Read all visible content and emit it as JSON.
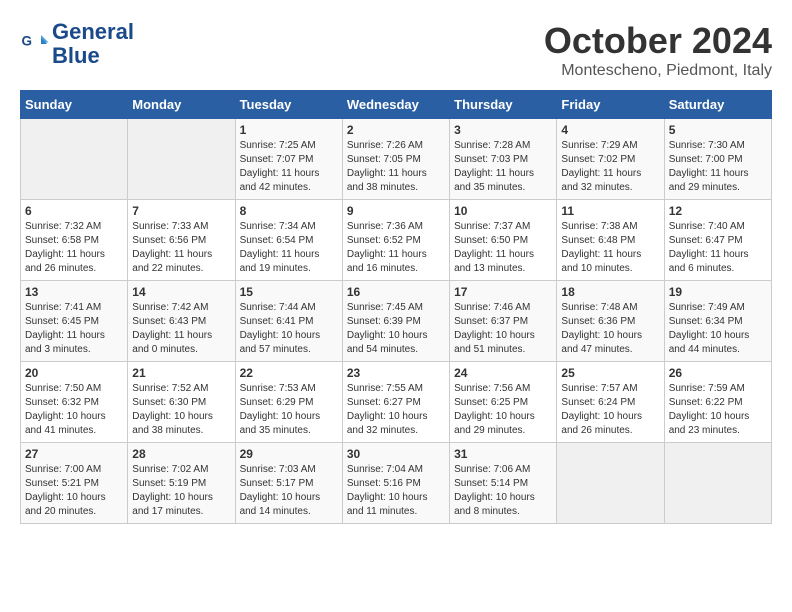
{
  "header": {
    "logo_line1": "General",
    "logo_line2": "Blue",
    "month": "October 2024",
    "location": "Montescheno, Piedmont, Italy"
  },
  "weekdays": [
    "Sunday",
    "Monday",
    "Tuesday",
    "Wednesday",
    "Thursday",
    "Friday",
    "Saturday"
  ],
  "weeks": [
    [
      {
        "day": "",
        "info": ""
      },
      {
        "day": "",
        "info": ""
      },
      {
        "day": "1",
        "info": "Sunrise: 7:25 AM\nSunset: 7:07 PM\nDaylight: 11 hours\nand 42 minutes."
      },
      {
        "day": "2",
        "info": "Sunrise: 7:26 AM\nSunset: 7:05 PM\nDaylight: 11 hours\nand 38 minutes."
      },
      {
        "day": "3",
        "info": "Sunrise: 7:28 AM\nSunset: 7:03 PM\nDaylight: 11 hours\nand 35 minutes."
      },
      {
        "day": "4",
        "info": "Sunrise: 7:29 AM\nSunset: 7:02 PM\nDaylight: 11 hours\nand 32 minutes."
      },
      {
        "day": "5",
        "info": "Sunrise: 7:30 AM\nSunset: 7:00 PM\nDaylight: 11 hours\nand 29 minutes."
      }
    ],
    [
      {
        "day": "6",
        "info": "Sunrise: 7:32 AM\nSunset: 6:58 PM\nDaylight: 11 hours\nand 26 minutes."
      },
      {
        "day": "7",
        "info": "Sunrise: 7:33 AM\nSunset: 6:56 PM\nDaylight: 11 hours\nand 22 minutes."
      },
      {
        "day": "8",
        "info": "Sunrise: 7:34 AM\nSunset: 6:54 PM\nDaylight: 11 hours\nand 19 minutes."
      },
      {
        "day": "9",
        "info": "Sunrise: 7:36 AM\nSunset: 6:52 PM\nDaylight: 11 hours\nand 16 minutes."
      },
      {
        "day": "10",
        "info": "Sunrise: 7:37 AM\nSunset: 6:50 PM\nDaylight: 11 hours\nand 13 minutes."
      },
      {
        "day": "11",
        "info": "Sunrise: 7:38 AM\nSunset: 6:48 PM\nDaylight: 11 hours\nand 10 minutes."
      },
      {
        "day": "12",
        "info": "Sunrise: 7:40 AM\nSunset: 6:47 PM\nDaylight: 11 hours\nand 6 minutes."
      }
    ],
    [
      {
        "day": "13",
        "info": "Sunrise: 7:41 AM\nSunset: 6:45 PM\nDaylight: 11 hours\nand 3 minutes."
      },
      {
        "day": "14",
        "info": "Sunrise: 7:42 AM\nSunset: 6:43 PM\nDaylight: 11 hours\nand 0 minutes."
      },
      {
        "day": "15",
        "info": "Sunrise: 7:44 AM\nSunset: 6:41 PM\nDaylight: 10 hours\nand 57 minutes."
      },
      {
        "day": "16",
        "info": "Sunrise: 7:45 AM\nSunset: 6:39 PM\nDaylight: 10 hours\nand 54 minutes."
      },
      {
        "day": "17",
        "info": "Sunrise: 7:46 AM\nSunset: 6:37 PM\nDaylight: 10 hours\nand 51 minutes."
      },
      {
        "day": "18",
        "info": "Sunrise: 7:48 AM\nSunset: 6:36 PM\nDaylight: 10 hours\nand 47 minutes."
      },
      {
        "day": "19",
        "info": "Sunrise: 7:49 AM\nSunset: 6:34 PM\nDaylight: 10 hours\nand 44 minutes."
      }
    ],
    [
      {
        "day": "20",
        "info": "Sunrise: 7:50 AM\nSunset: 6:32 PM\nDaylight: 10 hours\nand 41 minutes."
      },
      {
        "day": "21",
        "info": "Sunrise: 7:52 AM\nSunset: 6:30 PM\nDaylight: 10 hours\nand 38 minutes."
      },
      {
        "day": "22",
        "info": "Sunrise: 7:53 AM\nSunset: 6:29 PM\nDaylight: 10 hours\nand 35 minutes."
      },
      {
        "day": "23",
        "info": "Sunrise: 7:55 AM\nSunset: 6:27 PM\nDaylight: 10 hours\nand 32 minutes."
      },
      {
        "day": "24",
        "info": "Sunrise: 7:56 AM\nSunset: 6:25 PM\nDaylight: 10 hours\nand 29 minutes."
      },
      {
        "day": "25",
        "info": "Sunrise: 7:57 AM\nSunset: 6:24 PM\nDaylight: 10 hours\nand 26 minutes."
      },
      {
        "day": "26",
        "info": "Sunrise: 7:59 AM\nSunset: 6:22 PM\nDaylight: 10 hours\nand 23 minutes."
      }
    ],
    [
      {
        "day": "27",
        "info": "Sunrise: 7:00 AM\nSunset: 5:21 PM\nDaylight: 10 hours\nand 20 minutes."
      },
      {
        "day": "28",
        "info": "Sunrise: 7:02 AM\nSunset: 5:19 PM\nDaylight: 10 hours\nand 17 minutes."
      },
      {
        "day": "29",
        "info": "Sunrise: 7:03 AM\nSunset: 5:17 PM\nDaylight: 10 hours\nand 14 minutes."
      },
      {
        "day": "30",
        "info": "Sunrise: 7:04 AM\nSunset: 5:16 PM\nDaylight: 10 hours\nand 11 minutes."
      },
      {
        "day": "31",
        "info": "Sunrise: 7:06 AM\nSunset: 5:14 PM\nDaylight: 10 hours\nand 8 minutes."
      },
      {
        "day": "",
        "info": ""
      },
      {
        "day": "",
        "info": ""
      }
    ]
  ]
}
